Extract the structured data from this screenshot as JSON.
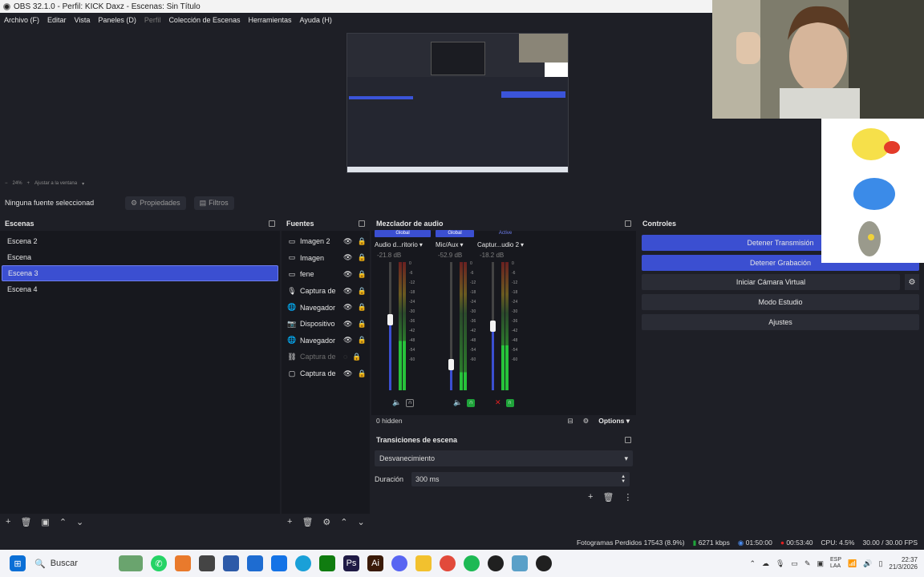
{
  "window": {
    "title": "OBS 32.1.0 - Perfil: KICK Daxz - Escenas: Sin Título"
  },
  "menu": [
    "Archivo (F)",
    "Editar",
    "Vista",
    "Paneles (D)",
    "Perfil",
    "Colección de Escenas",
    "Herramientas",
    "Ayuda (H)"
  ],
  "zoom": {
    "level": "24%",
    "fit": "Ajustar a la ventana"
  },
  "context": {
    "no_source": "Ninguna fuente seleccionad",
    "properties": "Propiedades",
    "filters": "Filtros"
  },
  "scenes": {
    "title": "Escenas",
    "items": [
      "Escena 2",
      "Escena",
      "Escena 3",
      "Escena 4"
    ],
    "selected_index": 2
  },
  "sources": {
    "title": "Fuentes",
    "items": [
      {
        "name": "Imagen 2",
        "icon": "image-icon"
      },
      {
        "name": "Imagen",
        "icon": "image-icon"
      },
      {
        "name": "fene",
        "icon": "image-icon"
      },
      {
        "name": "Captura de",
        "icon": "mic-icon"
      },
      {
        "name": "Navegador",
        "icon": "globe-icon"
      },
      {
        "name": "Dispositivo",
        "icon": "camera-icon"
      },
      {
        "name": "Navegador",
        "icon": "globe-icon"
      },
      {
        "name": "Captura de",
        "icon": "link-icon"
      },
      {
        "name": "Captura de",
        "icon": "monitor-icon"
      }
    ]
  },
  "mixer": {
    "title": "Mezclador de audio",
    "channels": [
      {
        "badge": "Global",
        "name": "Audio d...ritorio",
        "db": "-21.8 dB",
        "level": 0.55
      },
      {
        "badge": "Global",
        "name": "Mic/Aux",
        "db": "-52.9 dB",
        "level": 0.2
      },
      {
        "badge": "Active",
        "name": "Captur...udio 2",
        "db": "-18.2 dB",
        "level": 0.5
      }
    ],
    "scale": [
      "0",
      "-6",
      "-12",
      "-18",
      "-24",
      "-30",
      "-36",
      "-42",
      "-48",
      "-54",
      "-60"
    ],
    "hidden": "0 hidden",
    "options": "Options"
  },
  "transitions": {
    "title": "Transiciones de escena",
    "type": "Desvanecimiento",
    "duration_label": "Duración",
    "duration": "300 ms"
  },
  "controls": {
    "title": "Controles",
    "buttons": [
      "Detener Transmisión",
      "Detener Grabación",
      "Iniciar Cámara Virtual",
      "Modo Estudio",
      "Ajustes"
    ]
  },
  "status": {
    "dropped": "Fotogramas Perdidos 17543 (8.9%)",
    "bitrate": "6271 kbps",
    "stream_time": "01:50:00",
    "rec_time": "00:53:40",
    "cpu": "CPU: 4.5%",
    "fps": "30.00 / 30.00 FPS"
  },
  "taskbar": {
    "search": "Buscar",
    "lang": "ESP\nLAA",
    "time": "22:37",
    "date": "21/3/2026"
  },
  "colors": {
    "accent": "#3b4fd1",
    "green": "#1fa33a",
    "record": "#e02020"
  }
}
